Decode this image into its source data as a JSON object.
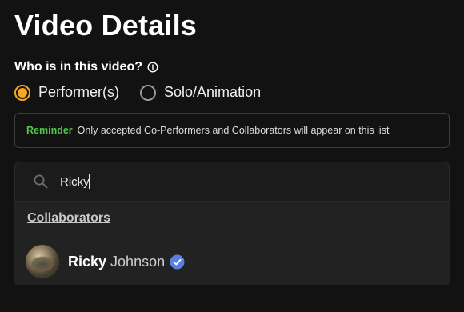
{
  "page": {
    "title": "Video Details"
  },
  "question": {
    "label": "Who is in this video?",
    "info_icon": "info-icon"
  },
  "radio_options": [
    {
      "label": "Performer(s)",
      "checked": true
    },
    {
      "label": "Solo/Animation",
      "checked": false
    }
  ],
  "reminder": {
    "tag": "Reminder",
    "text": "Only accepted Co-Performers and Collaborators will appear on this list"
  },
  "search": {
    "value": "Ricky",
    "icon": "search-icon"
  },
  "dropdown": {
    "section_heading": "Collaborators",
    "results": [
      {
        "first_name": "Ricky",
        "last_name": "Johnson",
        "verified": true,
        "icon": "verified-badge-icon"
      }
    ]
  },
  "colors": {
    "background": "#121212",
    "accent": "#f5a623",
    "reminder_tag": "#4fc94f",
    "verified_badge": "#5b7fe0"
  }
}
